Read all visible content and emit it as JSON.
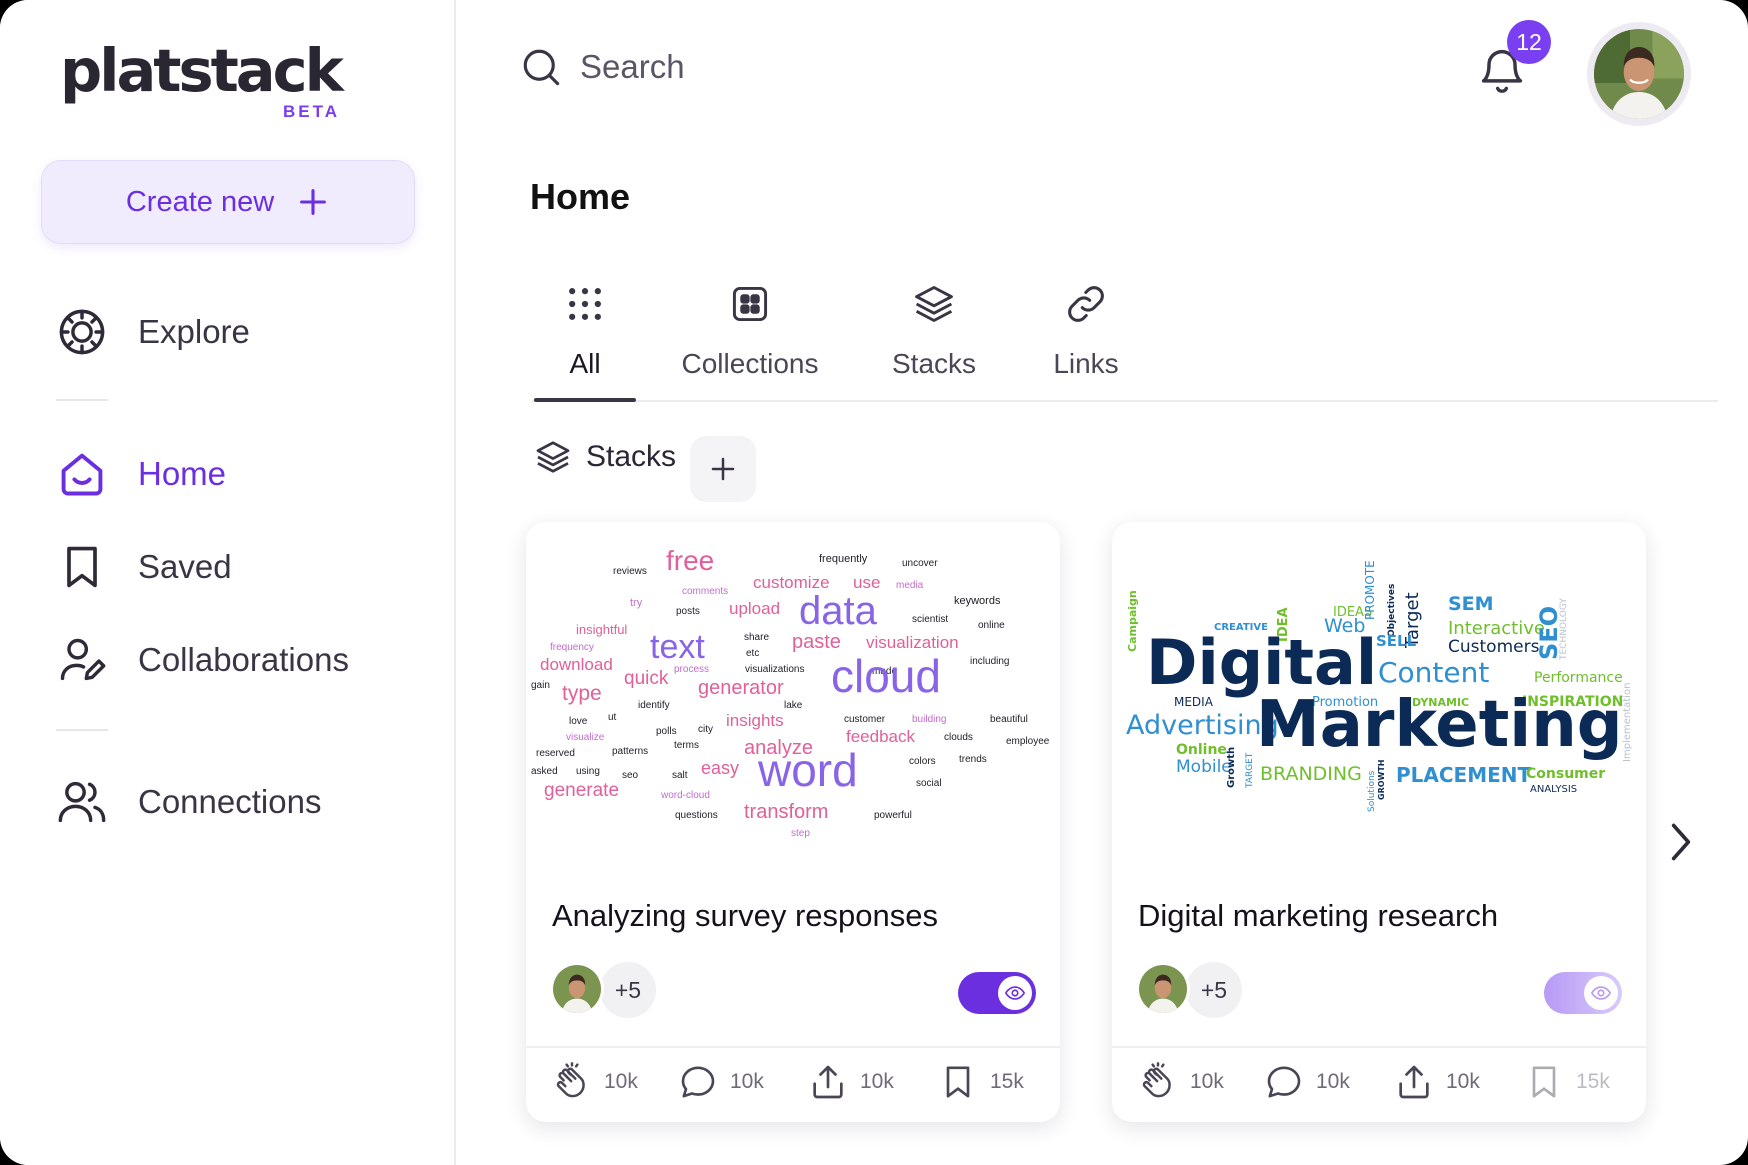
{
  "brand": {
    "name": "platstack",
    "tag": "BETA"
  },
  "sidebar": {
    "create_label": "Create new",
    "items": [
      {
        "label": "Explore",
        "icon": "compass-icon"
      },
      {
        "label": "Home",
        "icon": "home-icon",
        "active": true
      },
      {
        "label": "Saved",
        "icon": "bookmark-icon"
      },
      {
        "label": "Collaborations",
        "icon": "user-edit-icon"
      },
      {
        "label": "Connections",
        "icon": "users-icon"
      }
    ]
  },
  "header": {
    "search_placeholder": "Search",
    "notification_count": "12"
  },
  "page": {
    "title": "Home",
    "tabs": [
      {
        "label": "All",
        "icon": "grid-dots-icon",
        "active": true
      },
      {
        "label": "Collections",
        "icon": "collection-icon"
      },
      {
        "label": "Stacks",
        "icon": "layers-icon"
      },
      {
        "label": "Links",
        "icon": "link-icon"
      }
    ],
    "section_label": "Stacks"
  },
  "cards": [
    {
      "title": "Analyzing survey responses",
      "extra_members": "+5",
      "visible": true,
      "stats": {
        "claps": "10k",
        "comments": "10k",
        "shares": "10k",
        "saves": "15k"
      },
      "image_words": [
        "free",
        "frequently",
        "uncover",
        "reviews",
        "comments",
        "customize",
        "use",
        "media",
        "try",
        "posts",
        "upload",
        "data",
        "scientist",
        "keywords",
        "insightful",
        "share",
        "paste",
        "visualization",
        "online",
        "frequency",
        "text",
        "etc",
        "download",
        "process",
        "visualizations",
        "made",
        "including",
        "gain",
        "quick",
        "cloud",
        "type",
        "generator",
        "identify",
        "lake",
        "love",
        "ut",
        "insights",
        "building",
        "beautiful",
        "polls",
        "city",
        "feedback",
        "visualize",
        "customer",
        "clouds",
        "employee",
        "reserved",
        "patterns",
        "terms",
        "analyze",
        "colors",
        "trends",
        "asked",
        "using",
        "seo",
        "salt",
        "easy",
        "word",
        "social",
        "generate",
        "word-cloud",
        "questions",
        "transform",
        "powerful",
        "step"
      ]
    },
    {
      "title": "Digital marketing research",
      "extra_members": "+5",
      "visible": false,
      "stats": {
        "claps": "10k",
        "comments": "10k",
        "shares": "10k",
        "saves": "15k"
      },
      "image_words": [
        "Campaign",
        "CREATIVE",
        "IDEA",
        "IDEAS",
        "PROMOTE",
        "Objectives",
        "Target",
        "SEM",
        "Digital",
        "Web",
        "Interactive",
        "SELL",
        "Customers",
        "SEO",
        "TECHNOLOGY",
        "Performance",
        "Content",
        "MEDIA",
        "Promotion",
        "DYNAMIC",
        "INSPIRATION",
        "Advertising",
        "Marketing",
        "Implementation",
        "Online",
        "Mobile",
        "Growth",
        "TARGET",
        "BRANDING",
        "Solutions",
        "GROWTH",
        "PLACEMENT",
        "Consumer",
        "ANALYSIS"
      ]
    }
  ],
  "colors": {
    "accent": "#6b2fe0",
    "badge": "#7b3ff2",
    "create_bg": "#f1ecfd"
  }
}
